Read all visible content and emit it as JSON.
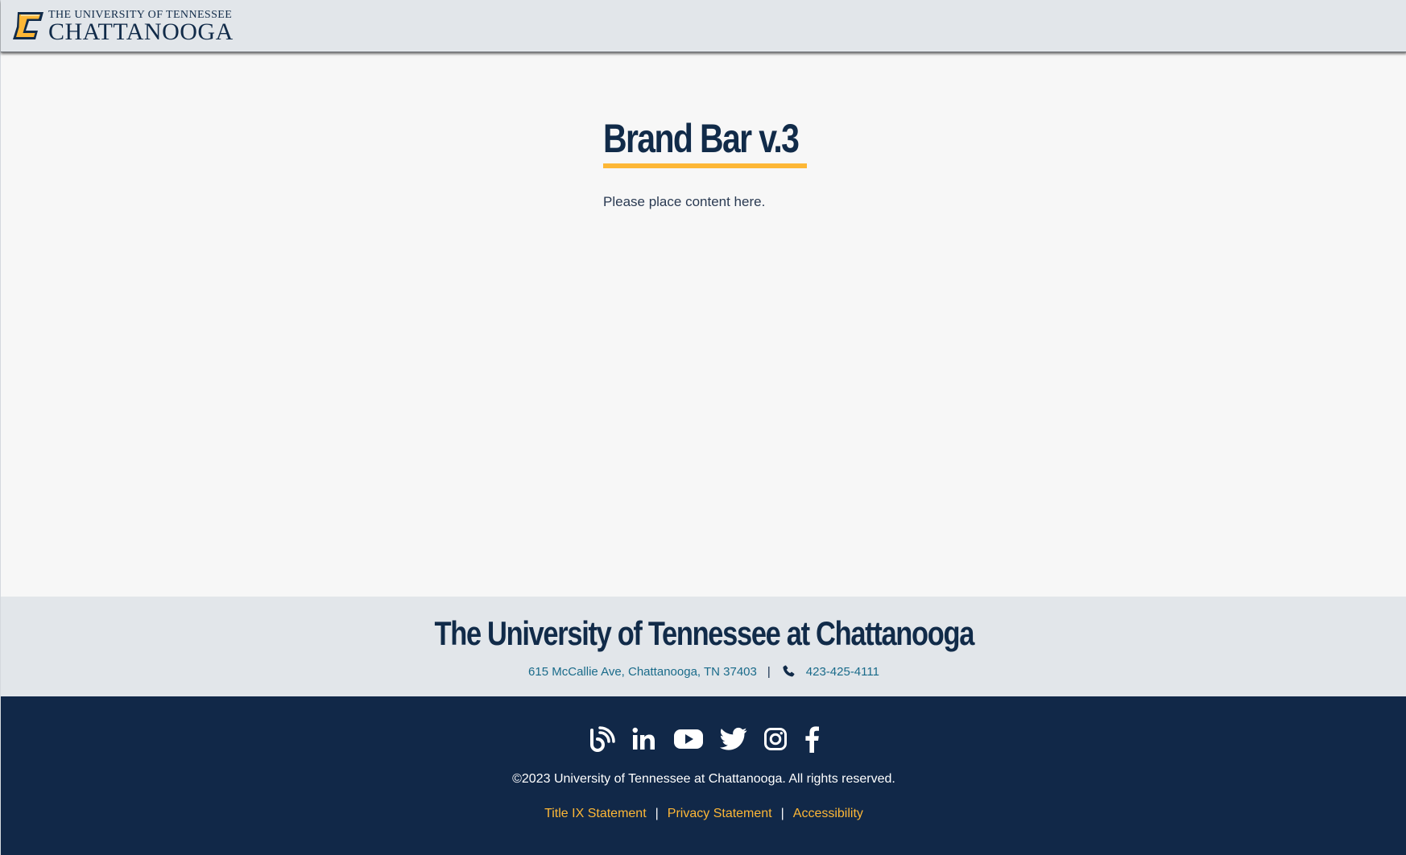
{
  "brand_bar": {
    "logo_line1": "THE UNIVERSITY OF TENNESSEE",
    "logo_line2": "CHATTANOOGA",
    "logo_letter": "C"
  },
  "main": {
    "title": "Brand Bar v.3",
    "body": "Please place content here."
  },
  "footer": {
    "university_name": "The University of Tennessee at Chattanooga",
    "address": "615 McCallie Ave, Chattanooga, TN 37403",
    "separator": "|",
    "phone": "423-425-4111",
    "social": [
      {
        "icon": "blog-icon"
      },
      {
        "icon": "linkedin-icon"
      },
      {
        "icon": "youtube-icon"
      },
      {
        "icon": "twitter-icon"
      },
      {
        "icon": "instagram-icon"
      },
      {
        "icon": "facebook-icon"
      }
    ],
    "copyright": "©2023 University of Tennessee at Chattanooga. All rights reserved.",
    "legal_links": {
      "title_ix": "Title IX Statement",
      "privacy": "Privacy Statement",
      "accessibility": "Accessibility",
      "separator": "|"
    }
  },
  "colors": {
    "navy": "#112b49",
    "gold": "#fdb736",
    "link_teal": "#1a6b8a",
    "bar_gray": "#e2e6ea",
    "page_bg": "#f7f7f7",
    "footer_navy": "#112848"
  }
}
